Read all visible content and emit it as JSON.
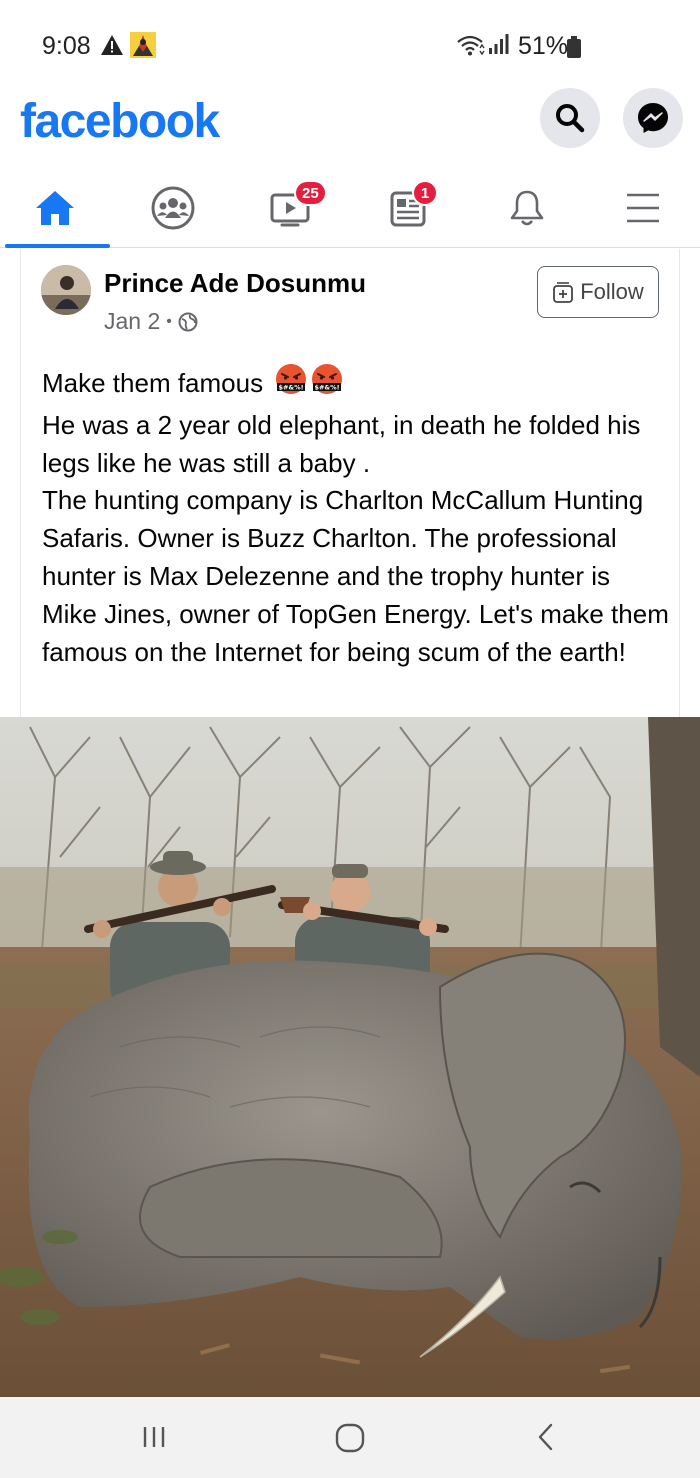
{
  "status_bar": {
    "time": "9:08",
    "battery": "51%",
    "warning_icon": "warning-triangle-icon",
    "app_icon": "app-notification-icon",
    "wifi_icon": "wifi-icon",
    "signal_icon": "signal-bars-icon",
    "battery_icon": "battery-icon"
  },
  "header": {
    "logo": "facebook",
    "search_icon": "search-icon",
    "messenger_icon": "messenger-icon",
    "accent": "#1877f2"
  },
  "nav": {
    "tabs": [
      {
        "name": "home",
        "icon": "home-icon",
        "active": true,
        "badge": ""
      },
      {
        "name": "groups",
        "icon": "groups-icon",
        "active": false,
        "badge": ""
      },
      {
        "name": "watch",
        "icon": "video-icon",
        "active": false,
        "badge": "25"
      },
      {
        "name": "news",
        "icon": "news-feed-icon",
        "active": false,
        "badge": "1"
      },
      {
        "name": "notifications",
        "icon": "bell-icon",
        "active": false,
        "badge": ""
      },
      {
        "name": "menu",
        "icon": "hamburger-menu-icon",
        "active": false,
        "badge": ""
      }
    ]
  },
  "post": {
    "author": "Prince Ade Dosunmu",
    "date": "Jan 2",
    "separator": "•",
    "privacy_icon": "globe-icon",
    "follow_label": "Follow",
    "lines": [
      "Make them famous",
      "He was a 2 year old elephant, in death he folded his legs like he was still a baby .",
      "The hunting company is Charlton McCallum Hunting Safaris. Owner is Buzz Charlton. The professional hunter is Max Delezenne and the trophy hunter is Mike Jines, owner of TopGen Energy. Let's make them famous on the Internet for being scum of the earth!"
    ],
    "emoji_caption": "$#&%!",
    "photo": "photo of two hunters holding rifles behind a dead young elephant in dry bushland"
  },
  "android_nav": {
    "recents_icon": "recent-apps-icon",
    "home_icon": "android-home-icon",
    "back_icon": "back-chevron-icon"
  }
}
